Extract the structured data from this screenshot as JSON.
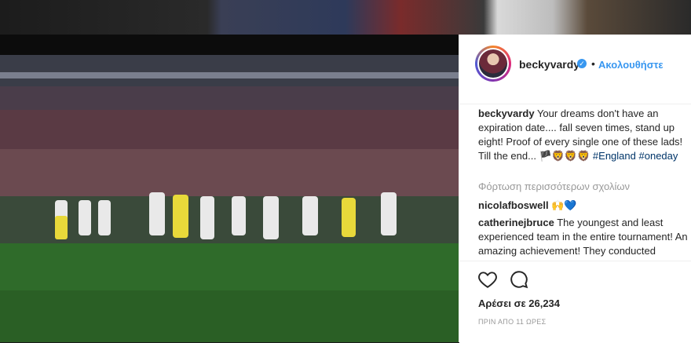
{
  "post": {
    "username": "beckyvardy",
    "follow_label": "Ακολουθήστε",
    "dot": "•",
    "verified_glyph": "✓",
    "caption_text": "Your dreams don't have an expiration date.... fall seven times, stand up eight! Proof of every single one of these lads! Till the end... 🏴🦁🦁🦁 ",
    "hashtag_england": "#England",
    "hashtag_oneday": "#oneday",
    "load_more": "Φόρτωση περισσότερων σχολίων",
    "comments": [
      {
        "user": "nicolafboswell",
        "text": " 🙌💙"
      },
      {
        "user": "catherinejbruce",
        "text": " The youngest and least experienced team in the entire tournament! An amazing achievement! They conducted themselves with such Grace and dignity and"
      }
    ],
    "likes": "Αρέσει σε 26,234",
    "timestamp": "ΠΡΙΝ ΑΠΟ 11 ΩΡΕΣ"
  },
  "colors": {
    "accent": "#3897f0",
    "text": "#262626",
    "muted": "#999999"
  },
  "icons": [
    "verified-badge-icon",
    "heart-icon",
    "comment-bubble-icon"
  ]
}
